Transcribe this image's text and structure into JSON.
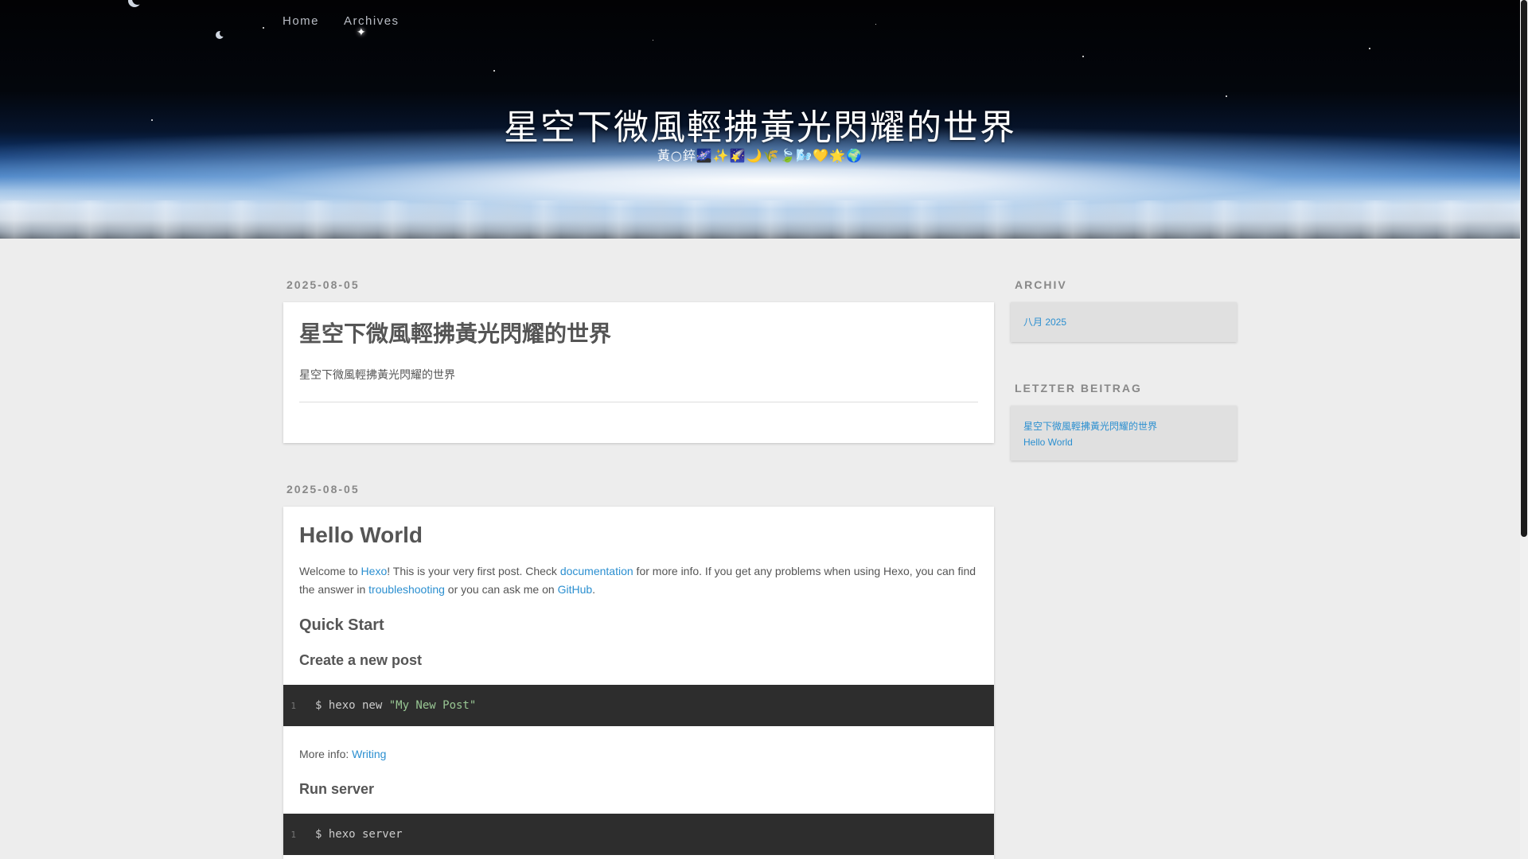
{
  "nav": {
    "items": [
      {
        "label": "Home"
      },
      {
        "label": "Archives"
      }
    ]
  },
  "site": {
    "title": "星空下微風輕拂黃光閃耀的世界",
    "subtitle": "黃○錊🌌✨🌠🌙🌾🍃🌬️💛🌟🌍"
  },
  "posts": [
    {
      "date": "2025-08-05",
      "title": "星空下微風輕拂黃光閃耀的世界",
      "excerpt": "星空下微風輕拂黃光閃耀的世界"
    },
    {
      "date": "2025-08-05",
      "title": "Hello World",
      "intro": {
        "t1": "Welcome to ",
        "link_hexo": "Hexo",
        "t2": "! This is your very first post. Check ",
        "link_docs": "documentation",
        "t3": " for more info. If you get any problems when using Hexo, you can find the answer in ",
        "link_trouble": "troubleshooting",
        "t4": " or you can ask me on ",
        "link_github": "GitHub",
        "t5": "."
      },
      "h_quick_start": "Quick Start",
      "h_create_post": "Create a new post",
      "code1": {
        "line": "1",
        "cmd": "$ hexo new ",
        "str": "\"My New Post\""
      },
      "more_info_label": "More info: ",
      "more_info_link": "Writing",
      "h_run_server": "Run server",
      "code2": {
        "line": "1",
        "cmd": "$ hexo server"
      }
    }
  ],
  "sidebar": {
    "archive": {
      "title": "ARCHIV",
      "items": [
        {
          "label": "八月 2025"
        }
      ]
    },
    "recent": {
      "title": "LETZTER BEITRAG",
      "items": [
        {
          "label": "星空下微風輕拂黃光閃耀的世界"
        },
        {
          "label": "Hello World"
        }
      ]
    }
  },
  "colors": {
    "link": "#2b8fd0",
    "background": "#ededed",
    "code_bg": "#2d2d2d",
    "code_string": "#99c794"
  },
  "icons": [
    "moon-icon",
    "star-icon",
    "sparkle-icon"
  ]
}
